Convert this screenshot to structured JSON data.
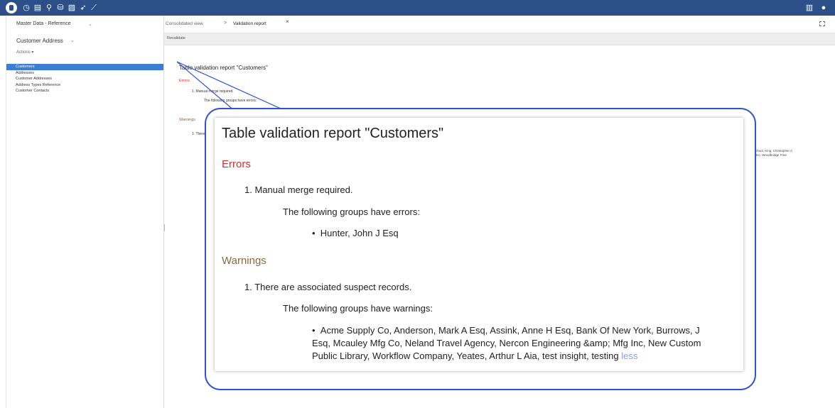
{
  "header": {
    "brand_color": "#2b4f86",
    "icons": [
      "home-icon",
      "clock-icon",
      "document-icon",
      "search-icon",
      "database-icon",
      "file-icon",
      "pin-icon",
      "wrench-icon"
    ],
    "right_icons": [
      "grid-icon",
      "user-icon"
    ]
  },
  "sidebar": {
    "dataspace": "Master Data - Reference",
    "dataset": "Customer Address",
    "actions": "Actions ▾",
    "items": [
      {
        "label": "Customers",
        "active": true
      },
      {
        "label": "Addresses"
      },
      {
        "label": "Customer Addresses"
      },
      {
        "label": "Address Types Reference"
      },
      {
        "label": "Customer Contacts"
      }
    ]
  },
  "main": {
    "breadcrumb": [
      "Consolidated view",
      "Validation report"
    ],
    "breadcrumb_separator": ">",
    "tab_close": "×",
    "toolbar": {
      "revalidate": "Revalidate"
    },
    "report_bg": {
      "title": "Table validation report \"Customers\"",
      "errors": "Errors",
      "error_item": "1. Manual merge required.",
      "error_sub": "The following groups have errors:",
      "warnings": "Warnings",
      "warning_item": "1. There are associated suspect records."
    },
    "right_fragment": [
      "School, King, Christopher A",
      "n Inc, Woodbridge Free"
    ]
  },
  "callout": {
    "border_color": "#2f4fd6",
    "title": "Table validation report \"Customers\"",
    "errors_heading": "Errors",
    "error_item": "1. Manual merge required.",
    "error_sub": "The following groups have errors:",
    "error_group": "Hunter, John J Esq",
    "warnings_heading": "Warnings",
    "warning_item": "1. There are associated suspect records.",
    "warning_sub": "The following groups have warnings:",
    "warning_groups_lines": [
      "Acme Supply Co, Anderson, Mark A Esq, Assink, Anne H Esq, Bank Of New York, Burrows, J",
      "Esq, Mcauley Mfg Co, Neland Travel Agency, Nercon Engineering &amp; Mfg Inc, New Custom",
      "Public Library, Workflow Company, Yeates, Arthur L Aia, test insight, testing "
    ],
    "less_link": "less"
  }
}
